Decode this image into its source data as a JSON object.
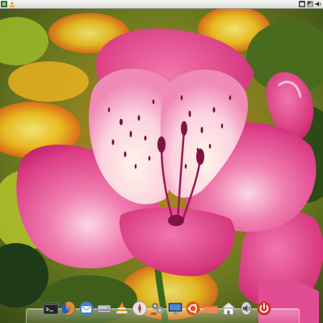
{
  "desktop": {
    "wallpaper": "pink-alstroemeria-flower",
    "accent_colors": {
      "petal_pink": "#e0458a",
      "petal_light": "#f6c1d8",
      "background_green": "#6f8c22",
      "background_yellow": "#f2c21a",
      "background_orange": "#e86a1a"
    }
  },
  "top_panel": {
    "left_icons": [
      "menu-icon",
      "vlc-tray-icon"
    ],
    "right_icons": [
      "tray-window-icon",
      "tray-network-icon",
      "tray-volume-icon"
    ]
  },
  "dock": {
    "items": [
      {
        "icon": "terminal-icon"
      },
      {
        "icon": "firefox-icon"
      },
      {
        "icon": "thunderbird-icon"
      },
      {
        "icon": "drive-icon"
      },
      {
        "icon": "vlc-icon"
      },
      {
        "icon": "web-browser-icon"
      },
      {
        "icon": "settings-tools-icon"
      },
      {
        "icon": "display-icon"
      },
      {
        "icon": "ubuntu-icon"
      },
      {
        "icon": "folder-icon"
      },
      {
        "icon": "home-icon"
      },
      {
        "icon": "volume-icon"
      },
      {
        "icon": "power-icon"
      }
    ]
  }
}
